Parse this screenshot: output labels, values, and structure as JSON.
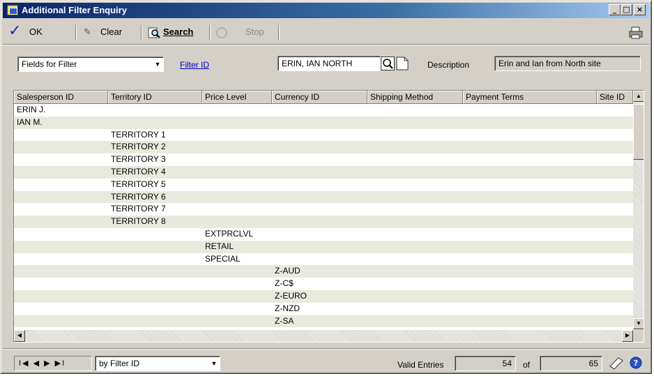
{
  "window": {
    "title": "Additional Filter Enquiry",
    "controls": [
      "_",
      "□",
      "×"
    ]
  },
  "toolbar": {
    "ok_label": "OK",
    "clear_label": "Clear",
    "search_label": "Search",
    "stop_label": "Stop"
  },
  "filter": {
    "fields_dropdown_value": "Fields for Filter",
    "filter_id_label": "Filter ID",
    "filter_id_value": "ERIN, IAN NORTH",
    "description_label": "Description",
    "description_value": "Erin and Ian from North site"
  },
  "grid": {
    "columns": [
      "Salesperson ID",
      "Territory ID",
      "Price Level",
      "Currency ID",
      "Shipping Method",
      "Payment Terms",
      "Site ID"
    ],
    "rows": [
      [
        "ERIN J.",
        "",
        "",
        "",
        "",
        "",
        ""
      ],
      [
        "IAN M.",
        "",
        "",
        "",
        "",
        "",
        ""
      ],
      [
        "",
        "TERRITORY 1",
        "",
        "",
        "",
        "",
        ""
      ],
      [
        "",
        "TERRITORY 2",
        "",
        "",
        "",
        "",
        ""
      ],
      [
        "",
        "TERRITORY 3",
        "",
        "",
        "",
        "",
        ""
      ],
      [
        "",
        "TERRITORY 4",
        "",
        "",
        "",
        "",
        ""
      ],
      [
        "",
        "TERRITORY 5",
        "",
        "",
        "",
        "",
        ""
      ],
      [
        "",
        "TERRITORY 6",
        "",
        "",
        "",
        "",
        ""
      ],
      [
        "",
        "TERRITORY 7",
        "",
        "",
        "",
        "",
        ""
      ],
      [
        "",
        "TERRITORY 8",
        "",
        "",
        "",
        "",
        ""
      ],
      [
        "",
        "",
        "EXTPRCLVL",
        "",
        "",
        "",
        ""
      ],
      [
        "",
        "",
        "RETAIL",
        "",
        "",
        "",
        ""
      ],
      [
        "",
        "",
        "SPECIAL",
        "",
        "",
        "",
        ""
      ],
      [
        "",
        "",
        "",
        "Z-AUD",
        "",
        "",
        ""
      ],
      [
        "",
        "",
        "",
        "Z-C$",
        "",
        "",
        ""
      ],
      [
        "",
        "",
        "",
        "Z-EURO",
        "",
        "",
        ""
      ],
      [
        "",
        "",
        "",
        "Z-NZD",
        "",
        "",
        ""
      ],
      [
        "",
        "",
        "",
        "Z-SA",
        "",
        "",
        ""
      ]
    ]
  },
  "footer": {
    "nav_symbols": "I◀ ◀ ▶ ▶I",
    "sort_value": "by Filter ID",
    "valid_entries_label": "Valid Entries",
    "valid_count": "54",
    "of_label": "of",
    "total_count": "65"
  }
}
